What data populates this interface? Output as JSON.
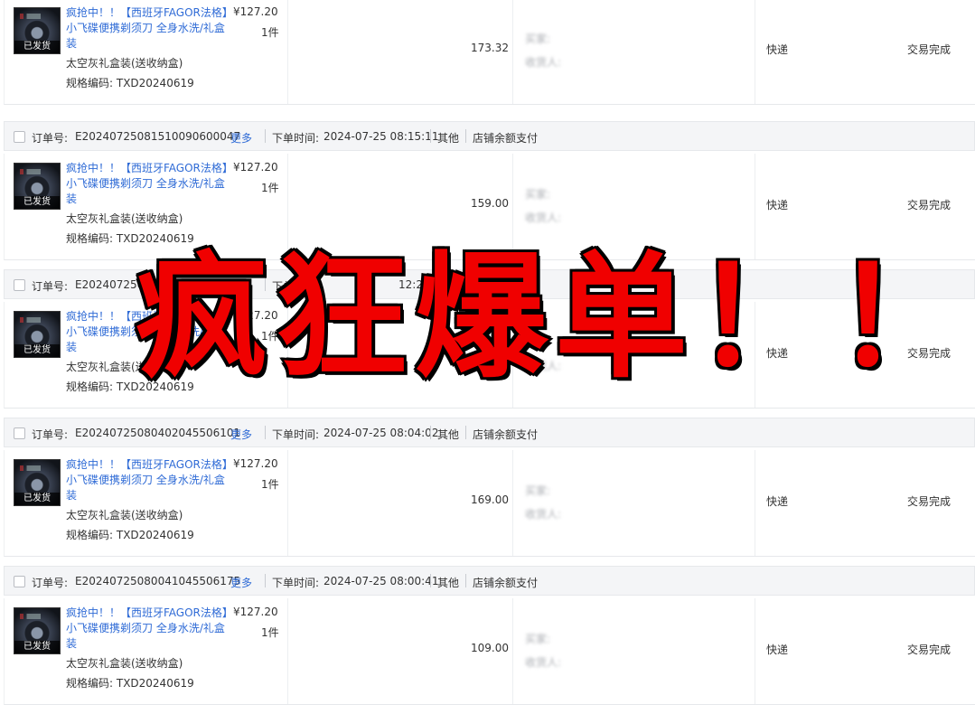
{
  "colors": {
    "link": "#2f6bd6",
    "overlay": "#f00000",
    "header_bg": "#f4f5f7"
  },
  "labels": {
    "order_no": "订单号:",
    "more": "更多",
    "order_time": "下单时间:",
    "other": "其他",
    "payment": "店铺余额支付",
    "shipped_badge": "已发货",
    "product_title": "疯抢中！！【西班牙FAGOR法格】小飞碟便携剃须刀 全身水洗/礼盒装",
    "spec": "太空灰礼盒装(送收纳盒)",
    "sku": "规格编码: TXD20240619",
    "price": "¥127.20",
    "qty": "1件",
    "buyer_label": "买家:",
    "receiver_label": "收货人:",
    "shipping": "快递",
    "status": "交易完成"
  },
  "orders": [
    {
      "order_no": "",
      "time": "",
      "title": "疯抢中！！【西班牙FAGOR法格】小飞碟便携剃须刀 全身水洗/礼盒装",
      "total": "173.32"
    },
    {
      "order_no": "E20240725081510090600047",
      "time": "2024-07-25 08:15:11",
      "title": "疯抢中！！【西班牙FAGOR法格】小飞碟便携剃须刀 全身水洗/礼盒装",
      "total": "159.00"
    },
    {
      "order_no": "E20240725081224090",
      "time": "12:24",
      "title": "疯抢中！！【西班牙FAGOR法格】小飞碟便携剃须刀 全身水洗/礼盒装",
      "total": ""
    },
    {
      "order_no": "E20240725080402045506101",
      "time": "2024-07-25 08:04:02",
      "title": "疯抢中！！【西班牙FAGOR法格】小飞碟便携剃须刀 全身水洗/礼盒装",
      "total": "169.00"
    },
    {
      "order_no": "E20240725080041045506175",
      "time": "2024-07-25 08:00:41",
      "title": "疯抢中！！【西班牙FAGOR法格】小飞碟便携剃须刀 全身水洗/礼盒装",
      "total": "109.00"
    }
  ],
  "overlay_text": "疯狂爆单！！"
}
